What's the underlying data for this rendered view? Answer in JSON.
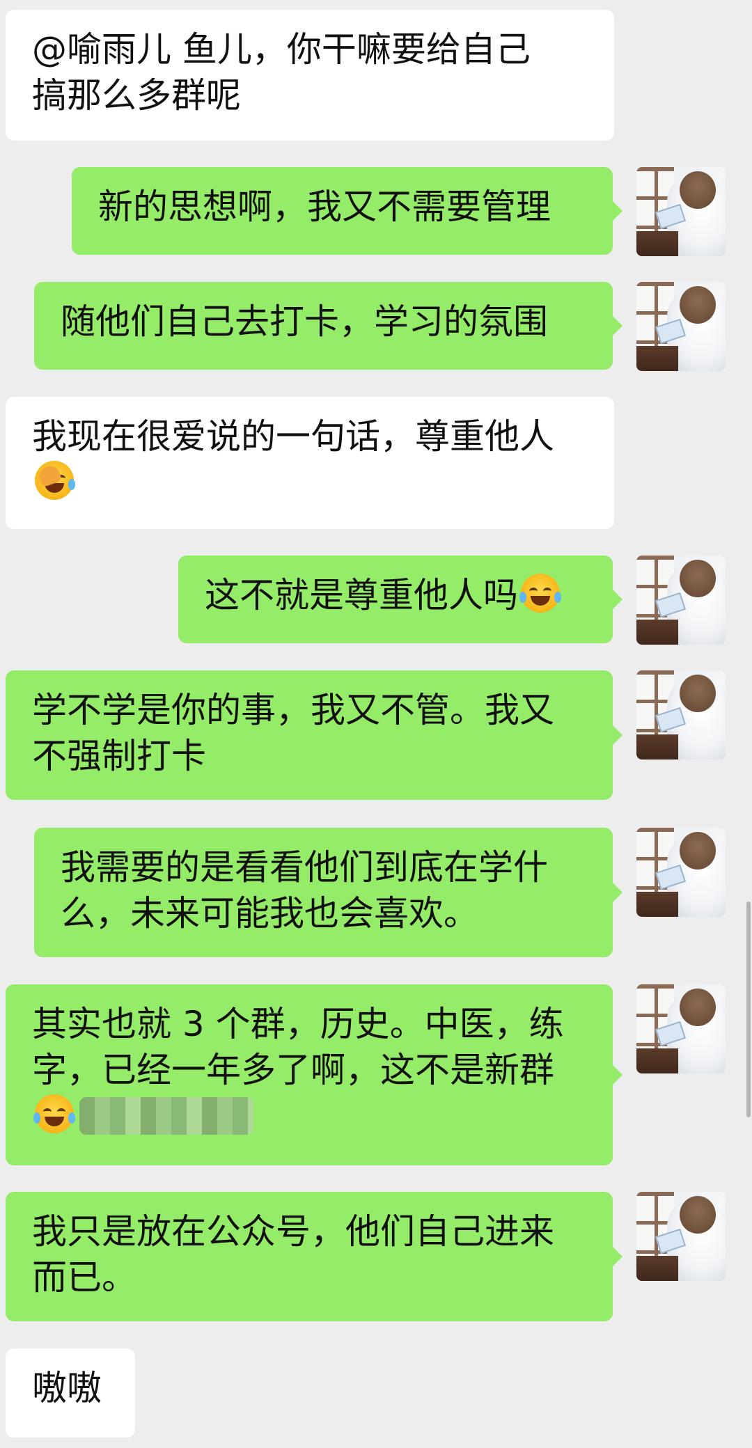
{
  "messages": [
    {
      "side": "in",
      "lines": [
        "@喻雨儿  鱼儿，你干嘛要给自己",
        "搞那么多群呢"
      ]
    },
    {
      "side": "out",
      "lines": [
        "新的思想啊，我又不需要管理"
      ]
    },
    {
      "side": "out",
      "lines": [
        "随他们自己去打卡，学习的氛围"
      ]
    },
    {
      "side": "in",
      "lines": [
        "我现在很爱说的一句话，尊重他人"
      ],
      "emoji": "facepalm"
    },
    {
      "side": "out",
      "lines": [
        "这不就是尊重他人吗"
      ],
      "emoji": "tears-of-joy"
    },
    {
      "side": "out",
      "lines": [
        "学不学是你的事，我又不管。我又",
        "不强制打卡"
      ]
    },
    {
      "side": "out",
      "lines": [
        "我需要的是看看他们到底在学什",
        "么，未来可能我也会喜欢。"
      ]
    },
    {
      "side": "out",
      "lines": [
        "其实也就 3 个群，历史。中医，练",
        "字，已经一年多了啊，这不是新群"
      ],
      "emoji": "tears-of-joy",
      "redacted": true
    },
    {
      "side": "out",
      "lines": [
        "我只是放在公众号，他们自己进来",
        "而已。"
      ]
    },
    {
      "side": "in",
      "lines": [
        "嗷嗷"
      ]
    }
  ],
  "colors": {
    "background": "#ededed",
    "incoming_bubble": "#ffffff",
    "outgoing_bubble": "#95ec69"
  },
  "icons": [
    "facepalm-emoji",
    "tears-of-joy-emoji",
    "user-avatar"
  ]
}
